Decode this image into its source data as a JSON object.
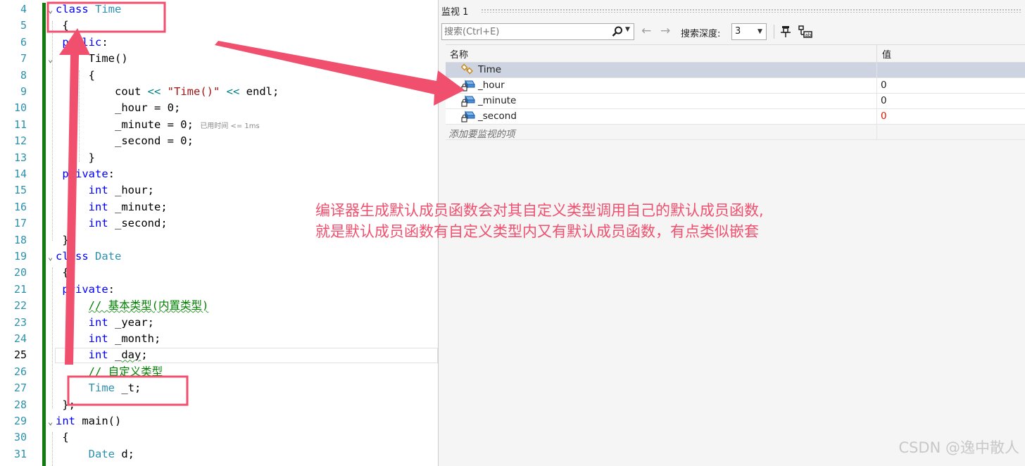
{
  "editor": {
    "line_numbers": [
      "4",
      "5",
      "6",
      "7",
      "8",
      "9",
      "10",
      "11",
      "12",
      "13",
      "14",
      "15",
      "16",
      "17",
      "18",
      "19",
      "20",
      "21",
      "22",
      "23",
      "24",
      "25",
      "26",
      "27",
      "28",
      "29",
      "30",
      "31"
    ],
    "current_line_index": 21,
    "lines": [
      [
        {
          "t": "class",
          "c": "kw"
        },
        {
          "t": " "
        },
        {
          "t": "Time",
          "c": "ty"
        }
      ],
      [
        {
          "t": " {"
        }
      ],
      [
        {
          "t": " public",
          "c": "kw"
        },
        {
          "t": ":"
        }
      ],
      [
        {
          "t": "     Time()"
        }
      ],
      [
        {
          "t": "     {"
        }
      ],
      [
        {
          "t": "         cout "
        },
        {
          "t": "<<",
          "c": "op"
        },
        {
          "t": " "
        },
        {
          "t": "\"Time()\"",
          "c": "str"
        },
        {
          "t": " "
        },
        {
          "t": "<<",
          "c": "op"
        },
        {
          "t": " endl;"
        }
      ],
      [
        {
          "t": "         _hour = 0;"
        }
      ],
      [
        {
          "t": "         _minute = 0; "
        },
        {
          "t": "已用时间 <= 1ms",
          "c": "hint"
        }
      ],
      [
        {
          "t": "         _second = 0;"
        }
      ],
      [
        {
          "t": "     }"
        }
      ],
      [
        {
          "t": " private",
          "c": "kw"
        },
        {
          "t": ":"
        }
      ],
      [
        {
          "t": "     "
        },
        {
          "t": "int",
          "c": "kw"
        },
        {
          "t": " _hour;"
        }
      ],
      [
        {
          "t": "     "
        },
        {
          "t": "int",
          "c": "kw"
        },
        {
          "t": " _minute;"
        }
      ],
      [
        {
          "t": "     "
        },
        {
          "t": "int",
          "c": "kw"
        },
        {
          "t": " _second;"
        }
      ],
      [
        {
          "t": " };"
        }
      ],
      [
        {
          "t": "class",
          "c": "kw"
        },
        {
          "t": " "
        },
        {
          "t": "Date",
          "c": "ty"
        }
      ],
      [
        {
          "t": " {"
        }
      ],
      [
        {
          "t": " private",
          "c": "kw"
        },
        {
          "t": ":"
        }
      ],
      [
        {
          "t": "     "
        },
        {
          "t": "// 基本类型(内置类型)",
          "c": "cm squig"
        }
      ],
      [
        {
          "t": "     "
        },
        {
          "t": "int",
          "c": "kw"
        },
        {
          "t": " _year;"
        }
      ],
      [
        {
          "t": "     "
        },
        {
          "t": "int",
          "c": "kw"
        },
        {
          "t": " _month;"
        }
      ],
      [
        {
          "t": "     "
        },
        {
          "t": "int",
          "c": "kw"
        },
        {
          "t": " _"
        },
        {
          "t": "day",
          "c": "squig"
        },
        {
          "t": ";"
        }
      ],
      [
        {
          "t": "     "
        },
        {
          "t": "// 自定义类型",
          "c": "cm"
        }
      ],
      [
        {
          "t": "     "
        },
        {
          "t": "Time",
          "c": "ty"
        },
        {
          "t": " _t;"
        }
      ],
      [
        {
          "t": " };"
        }
      ],
      [
        {
          "t": "int",
          "c": "kw"
        },
        {
          "t": " main()"
        }
      ],
      [
        {
          "t": " {"
        }
      ],
      [
        {
          "t": "     "
        },
        {
          "t": "Date",
          "c": "ty"
        },
        {
          "t": " d;"
        }
      ]
    ],
    "fold_lines": [
      0,
      3,
      15,
      25
    ]
  },
  "watch": {
    "title": "监视 1",
    "search": {
      "placeholder": "搜索(Ctrl+E)",
      "value": ""
    },
    "nav_back_icon": "arrow-left-icon",
    "nav_forward_icon": "arrow-right-icon",
    "depth_label": "搜索深度:",
    "depth_value": "3",
    "columns": {
      "name": "名称",
      "value": "值"
    },
    "rows": [
      {
        "name": "Time",
        "value": "",
        "icon": "class-icon",
        "selected": true,
        "changed": false
      },
      {
        "name": "_hour",
        "value": "0",
        "icon": "private-field-icon",
        "selected": false,
        "changed": false
      },
      {
        "name": "_minute",
        "value": "0",
        "icon": "private-field-icon",
        "selected": false,
        "changed": false
      },
      {
        "name": "_second",
        "value": "0",
        "icon": "private-field-icon",
        "selected": false,
        "changed": true
      }
    ],
    "add_item_placeholder": "添加要监视的项"
  },
  "annotation": {
    "note_line1": "编译器生成默认成员函数会对其自定义类型调用自己的默认成员函数,",
    "note_line2": "就是默认成员函数有自定义类型内又有默认成员函数，有点类似嵌套",
    "watermark": "CSDN @逸中散人",
    "color": "#f0506e"
  },
  "colors": {
    "keyword": "#0000ff",
    "type": "#2b91af",
    "string": "#a31515",
    "comment": "#008000",
    "changed_value": "#e51400",
    "selected_row": "#cdd3e0"
  }
}
